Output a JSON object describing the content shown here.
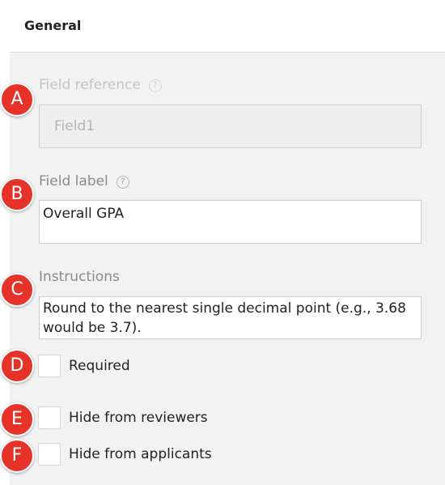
{
  "header": {
    "title": "General"
  },
  "fields": {
    "field_reference": {
      "label": "Field reference",
      "value": "Field1"
    },
    "field_label": {
      "label": "Field label",
      "value": "Overall GPA"
    },
    "instructions": {
      "label": "Instructions",
      "value": "Round to the nearest single decimal point (e.g., 3.68 would be 3.7)."
    }
  },
  "checkboxes": [
    {
      "label": "Required",
      "checked": false
    },
    {
      "label": "Hide from reviewers",
      "checked": false
    },
    {
      "label": "Hide from applicants",
      "checked": false
    }
  ],
  "markers": [
    "A",
    "B",
    "C",
    "D",
    "E",
    "F"
  ],
  "icons": {
    "help": "?"
  },
  "colors": {
    "marker": "#e5332a",
    "panel": "#f2f2f2",
    "field_border": "#cfcfcf"
  }
}
